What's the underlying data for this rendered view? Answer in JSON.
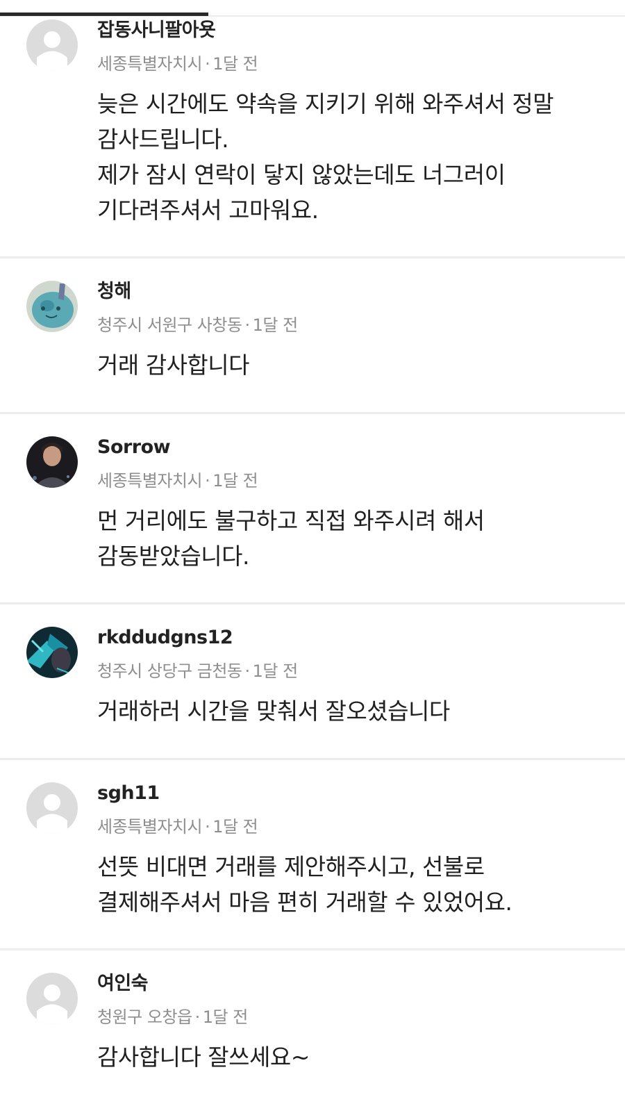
{
  "reviews": [
    {
      "nickname": "잡동사니팔아욧",
      "location": "세종특별자치시",
      "time": "1달 전",
      "avatar": "default-avatar-icon",
      "text": "늦은 시간에도 약속을 지키기 위해 와주셔서 정말\n감사드립니다.\n제가 잠시 연락이 닿지 않았는데도 너그러이\n기다려주셔서 고마워요."
    },
    {
      "nickname": "청해",
      "location": "청주시 서원구 사창동",
      "time": "1달 전",
      "avatar": "photo-avatar",
      "text": "거래 감사합니다"
    },
    {
      "nickname": "Sorrow",
      "location": "세종특별자치시",
      "time": "1달 전",
      "avatar": "photo-avatar",
      "text": "먼 거리에도 불구하고 직접 와주시려 해서\n감동받았습니다."
    },
    {
      "nickname": "rkddudgns12",
      "location": "청주시 상당구 금천동",
      "time": "1달 전",
      "avatar": "photo-avatar",
      "text": "거래하러 시간을 맞춰서 잘오셨습니다"
    },
    {
      "nickname": "sgh11",
      "location": "세종특별자치시",
      "time": "1달 전",
      "avatar": "default-avatar-icon",
      "text": "선뜻 비대면 거래를 제안해주시고, 선불로\n결제해주셔서 마음 편히 거래할 수 있었어요."
    },
    {
      "nickname": "여인숙",
      "location": "청원구 오창읍",
      "time": "1달 전",
      "avatar": "default-avatar-icon",
      "text": "감사합니다 잘쓰세요~"
    }
  ],
  "meta_separator": "·",
  "colors": {
    "default_avatar_bg": "#dcdcdc",
    "default_avatar_fg": "#ffffff",
    "divider": "#ededed",
    "meta_text": "#8e8e8e"
  }
}
